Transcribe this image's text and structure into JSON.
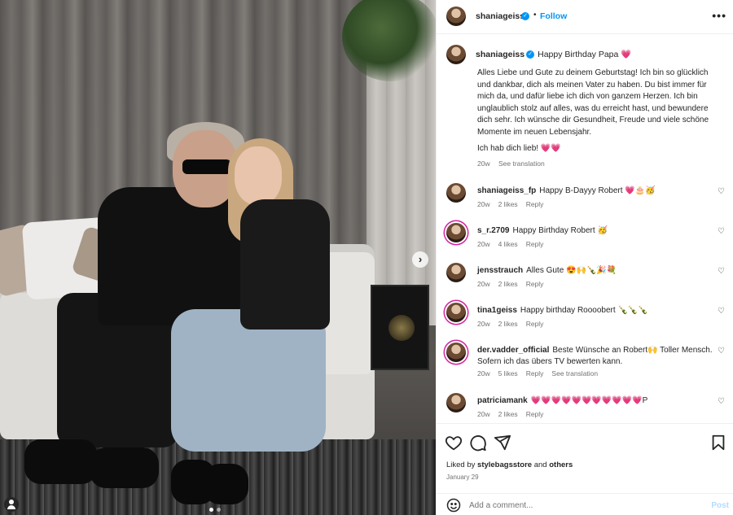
{
  "post": {
    "dots_count": 2,
    "active_dot": 0
  },
  "header": {
    "username": "shaniageiss",
    "separator": "•",
    "follow_label": "Follow",
    "more_label": "•••"
  },
  "caption": {
    "username": "shaniageiss",
    "title": "Happy Birthday Papa 💗",
    "body": "Alles Liebe und Gute zu deinem Geburtstag! Ich bin so glücklich und dankbar, dich als meinen Vater zu haben. Du bist immer für mich da, und dafür liebe ich dich von ganzem Herzen. Ich bin unglaublich stolz auf alles, was du erreicht hast, und bewundere dich sehr. Ich wünsche dir Gesundheit, Freude und viele schöne Momente im neuen Lebensjahr.",
    "closing": "Ich hab dich lieb! 💗💗",
    "age": "20w",
    "see_translation": "See translation"
  },
  "comments": [
    {
      "username": "shaniageiss_fp",
      "text": "Happy B-Dayyy Robert 💗🎂🥳",
      "age": "20w",
      "likes": "2 likes",
      "reply": "Reply",
      "translation": ""
    },
    {
      "username": "s_r.2709",
      "text": "Happy Birthday Robert 🥳",
      "age": "20w",
      "likes": "4 likes",
      "reply": "Reply",
      "translation": ""
    },
    {
      "username": "jensstrauch",
      "text": "Alles Gute 😍🙌🍾🎉💐",
      "age": "20w",
      "likes": "2 likes",
      "reply": "Reply",
      "translation": ""
    },
    {
      "username": "tina1geiss",
      "text": "Happy birthday Roooobert 🍾🍾🍾",
      "age": "20w",
      "likes": "2 likes",
      "reply": "Reply",
      "translation": ""
    },
    {
      "username": "der.vadder_official",
      "text": "Beste Wünsche an Robert🙌 Toller Mensch. Sofern ich das übers TV bewerten kann.",
      "age": "20w",
      "likes": "5 likes",
      "reply": "Reply",
      "translation": "See translation"
    },
    {
      "username": "patriciamank",
      "text": "💗💗💗💗💗💗💗💗💗💗💗P",
      "age": "20w",
      "likes": "2 likes",
      "reply": "Reply",
      "translation": ""
    }
  ],
  "footer": {
    "liked_prefix": "Liked by",
    "liked_user": "stylebagsstore",
    "liked_and": "and",
    "liked_others": "others",
    "date": "January 29",
    "comment_placeholder": "Add a comment...",
    "post_label": "Post"
  },
  "colors": {
    "accent": "#0095f6",
    "muted": "#737373",
    "text": "#262626",
    "heart": "#ed4956"
  }
}
